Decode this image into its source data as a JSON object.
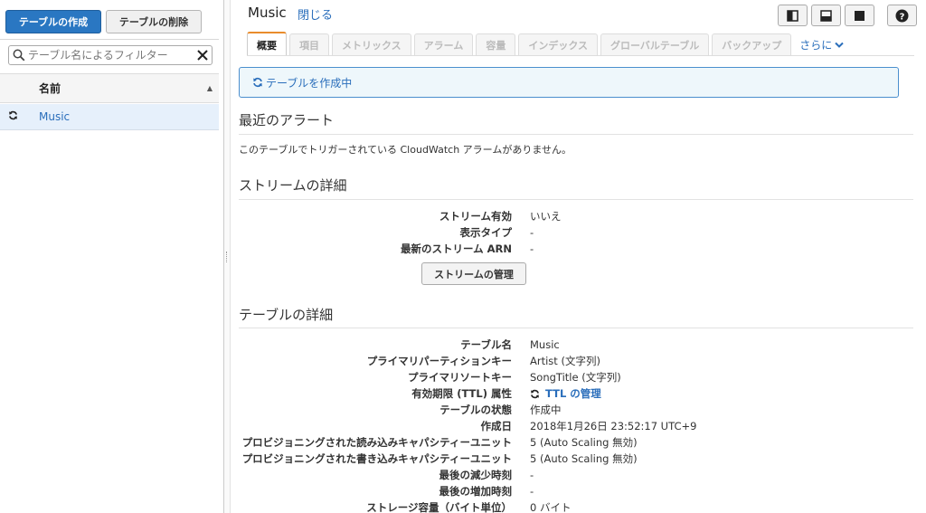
{
  "left_panel": {
    "create_button": "テーブルの作成",
    "delete_button": "テーブルの削除",
    "filter_placeholder": "テーブル名によるフィルター",
    "column_header": "名前",
    "selected_table": "Music"
  },
  "header": {
    "title": "Music",
    "close_link": "閉じる"
  },
  "tabs": [
    "概要",
    "項目",
    "メトリックス",
    "アラーム",
    "容量",
    "インデックス",
    "グローバルテーブル",
    "バックアップ"
  ],
  "more_tabs": "さらに",
  "status_alert": "テーブルを作成中",
  "alerts_section": {
    "title": "最近のアラート",
    "message": "このテーブルでトリガーされている CloudWatch アラームがありません。"
  },
  "stream_section": {
    "title": "ストリームの詳細",
    "rows": [
      {
        "key": "ストリーム有効",
        "value": "いいえ"
      },
      {
        "key": "表示タイプ",
        "value": "-"
      },
      {
        "key": "最新のストリーム ARN",
        "value": "-"
      }
    ],
    "manage_button": "ストリームの管理"
  },
  "table_section": {
    "title": "テーブルの詳細",
    "rows": [
      {
        "key": "テーブル名",
        "value": "Music"
      },
      {
        "key": "プライマリパーティションキー",
        "value": "Artist (文字列)"
      },
      {
        "key": "プライマリソートキー",
        "value": "SongTitle (文字列)"
      },
      {
        "key": "有効期限 (TTL) 属性",
        "value": "TTL の管理"
      },
      {
        "key": "テーブルの状態",
        "value": "作成中"
      },
      {
        "key": "作成日",
        "value": "2018年1月26日 23:52:17 UTC+9"
      },
      {
        "key": "プロビジョニングされた読み込みキャパシティーユニット",
        "value": "5 (Auto Scaling 無効)"
      },
      {
        "key": "プロビジョニングされた書き込みキャパシティーユニット",
        "value": "5 (Auto Scaling 無効)"
      },
      {
        "key": "最後の減少時刻",
        "value": "-"
      },
      {
        "key": "最後の増加時刻",
        "value": "-"
      },
      {
        "key": "ストレージ容量（バイト単位）",
        "value": "0 バイト"
      }
    ]
  },
  "colors": {
    "primary": "#2a77c2",
    "link": "#2a6ebb",
    "active_tab_accent": "#e98c2c",
    "alert_border": "#4b8fce",
    "alert_bg": "#eef7fb",
    "selected_row": "#e6f0fb"
  },
  "icons": {
    "search": "search-icon",
    "clear": "close-icon",
    "sort": "sort-up-icon",
    "refresh": "refresh-icon",
    "chevron": "chevron-down-icon",
    "help": "help-icon"
  }
}
